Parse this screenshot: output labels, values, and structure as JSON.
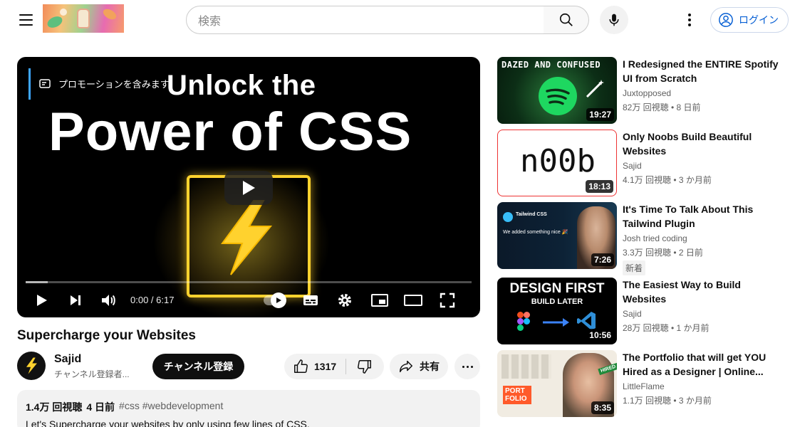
{
  "header": {
    "search_placeholder": "検索",
    "login_label": "ログイン"
  },
  "player": {
    "promo_label": "プロモーションを含みます",
    "overlay_line1": "Unlock the",
    "overlay_line2": "Power of CSS",
    "time": "0:00 / 6:17",
    "progress_loaded": 0.05,
    "progress_played": 0
  },
  "video": {
    "title": "Supercharge your Websites",
    "channel": "Sajid",
    "subscribers": "チャンネル登録者...",
    "subscribe_label": "チャンネル登録",
    "likes": "1317",
    "share_label": "共有",
    "views": "1.4万 回視聴",
    "age": "4 日前",
    "tags": "#css #webdevelopment",
    "description": "Let's Supercharge your websites by only using few lines of CSS."
  },
  "recommendations": [
    {
      "title": "I Redesigned the ENTIRE Spotify UI from Scratch",
      "channel": "Juxtopposed",
      "meta": "82万 回視聴 • 8 日前",
      "duration": "19:27",
      "thumb_text": "DAZED AND CONFUSED"
    },
    {
      "title": "Only Noobs Build Beautiful Websites",
      "channel": "Sajid",
      "meta": "4.1万 回視聴 • 3 か月前",
      "duration": "18:13",
      "thumb_text": "n00b"
    },
    {
      "title": "It's Time To Talk About This Tailwind Plugin",
      "channel": "Josh tried coding",
      "meta": "3.3万 回視聴 • 2 日前",
      "duration": "7:26",
      "badge": "新着",
      "thumb_text": "Tailwind CSS",
      "thumb_sub": "We added something nice 🎉"
    },
    {
      "title": "The Easiest Way to Build Websites",
      "channel": "Sajid",
      "meta": "28万 回視聴 • 1 か月前",
      "duration": "10:56",
      "thumb_text": "DESIGN FIRST",
      "thumb_sub": "BUILD LATER"
    },
    {
      "title": "The Portfolio that will get YOU Hired as a Designer | Online...",
      "channel": "LittleFlame",
      "meta": "1.1万 回視聴 • 3 か月前",
      "duration": "8:35",
      "thumb_text": "PORT FOLIO",
      "thumb_sub": "HIRED"
    }
  ]
}
